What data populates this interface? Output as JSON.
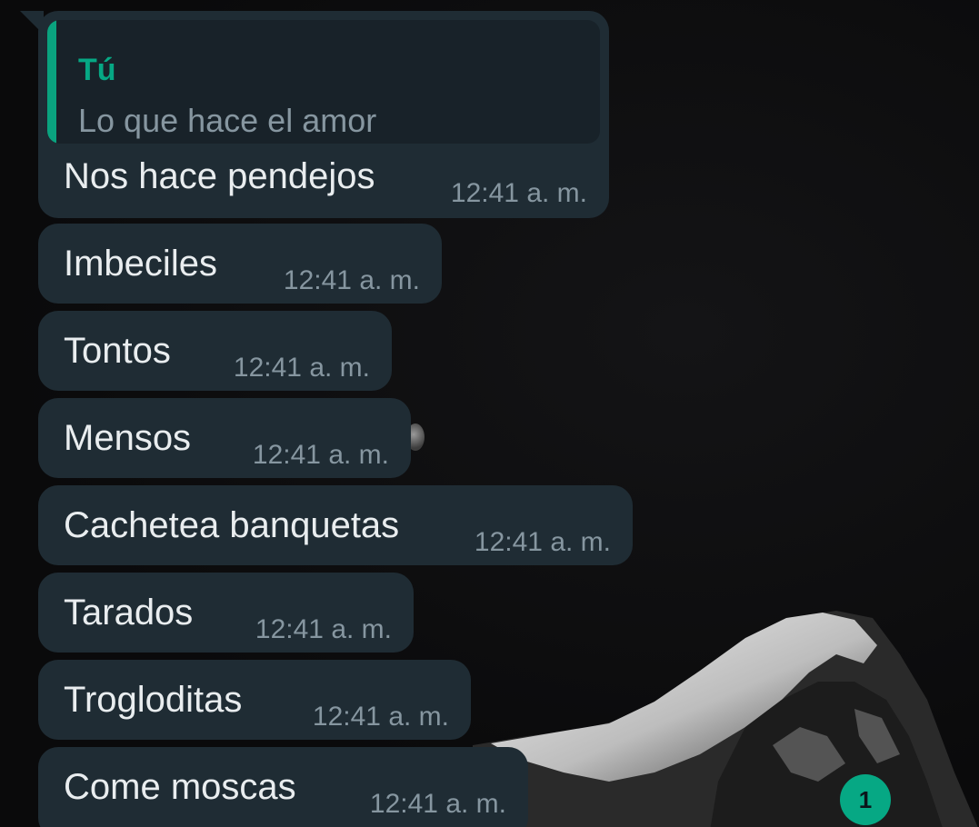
{
  "quoted": {
    "author": "Tú",
    "text": "Lo que hace el amor"
  },
  "messages": [
    {
      "text": "Nos hace pendejos",
      "time": "12:41 a. m."
    },
    {
      "text": "Imbeciles",
      "time": "12:41 a. m."
    },
    {
      "text": "Tontos",
      "time": "12:41 a. m."
    },
    {
      "text": "Mensos",
      "time": "12:41 a. m."
    },
    {
      "text": "Cachetea banquetas",
      "time": "12:41 a. m."
    },
    {
      "text": "Tarados",
      "time": "12:41 a. m."
    },
    {
      "text": "Trogloditas",
      "time": "12:41 a. m."
    },
    {
      "text": "Come moscas",
      "time": "12:41 a. m."
    }
  ],
  "unread_badge": "1",
  "colors": {
    "bubble": "#1f2c34",
    "accent": "#06a884",
    "timestamp": "#8696a0"
  }
}
